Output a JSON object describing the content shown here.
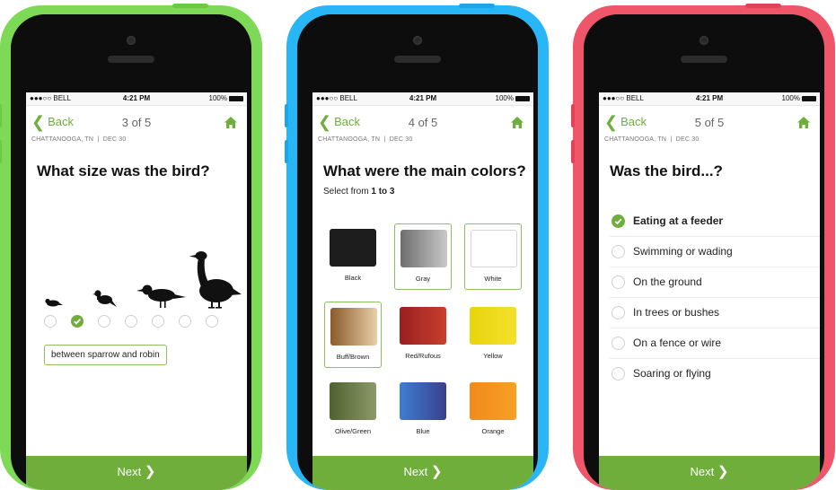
{
  "status": {
    "carrier": "●●●○○ BELL",
    "time": "4:21 PM",
    "battery": "100%"
  },
  "colors": {
    "accent": "#6fae3b",
    "phone1": "#7ed957",
    "phone2": "#29b6f6",
    "phone3": "#f0566a"
  },
  "common": {
    "back_label": "Back",
    "location": "CHATTANOOGA, TN",
    "date": "DEC 30",
    "next_label": "Next"
  },
  "screen1": {
    "step": "3 of 5",
    "question": "What size was the bird?",
    "size_count": 7,
    "selected_index": 1,
    "selected_label": "between sparrow and robin"
  },
  "screen2": {
    "step": "4 of 5",
    "question": "What were the main colors?",
    "instruction_prefix": "Select from",
    "instruction_range": "1 to 3",
    "swatches": [
      {
        "label": "Black",
        "selected": false
      },
      {
        "label": "Gray",
        "selected": true
      },
      {
        "label": "White",
        "selected": true
      },
      {
        "label": "Buff/Brown",
        "selected": true
      },
      {
        "label": "Red/Rufous",
        "selected": false
      },
      {
        "label": "Yellow",
        "selected": false
      },
      {
        "label": "Olive/Green",
        "selected": false
      },
      {
        "label": "Blue",
        "selected": false
      },
      {
        "label": "Orange",
        "selected": false
      }
    ]
  },
  "screen3": {
    "step": "5 of 5",
    "question": "Was the bird...?",
    "options": [
      {
        "label": "Eating at a feeder",
        "selected": true
      },
      {
        "label": "Swimming or wading",
        "selected": false
      },
      {
        "label": "On the ground",
        "selected": false
      },
      {
        "label": "In trees or bushes",
        "selected": false
      },
      {
        "label": "On a fence or wire",
        "selected": false
      },
      {
        "label": "Soaring or flying",
        "selected": false
      }
    ]
  }
}
